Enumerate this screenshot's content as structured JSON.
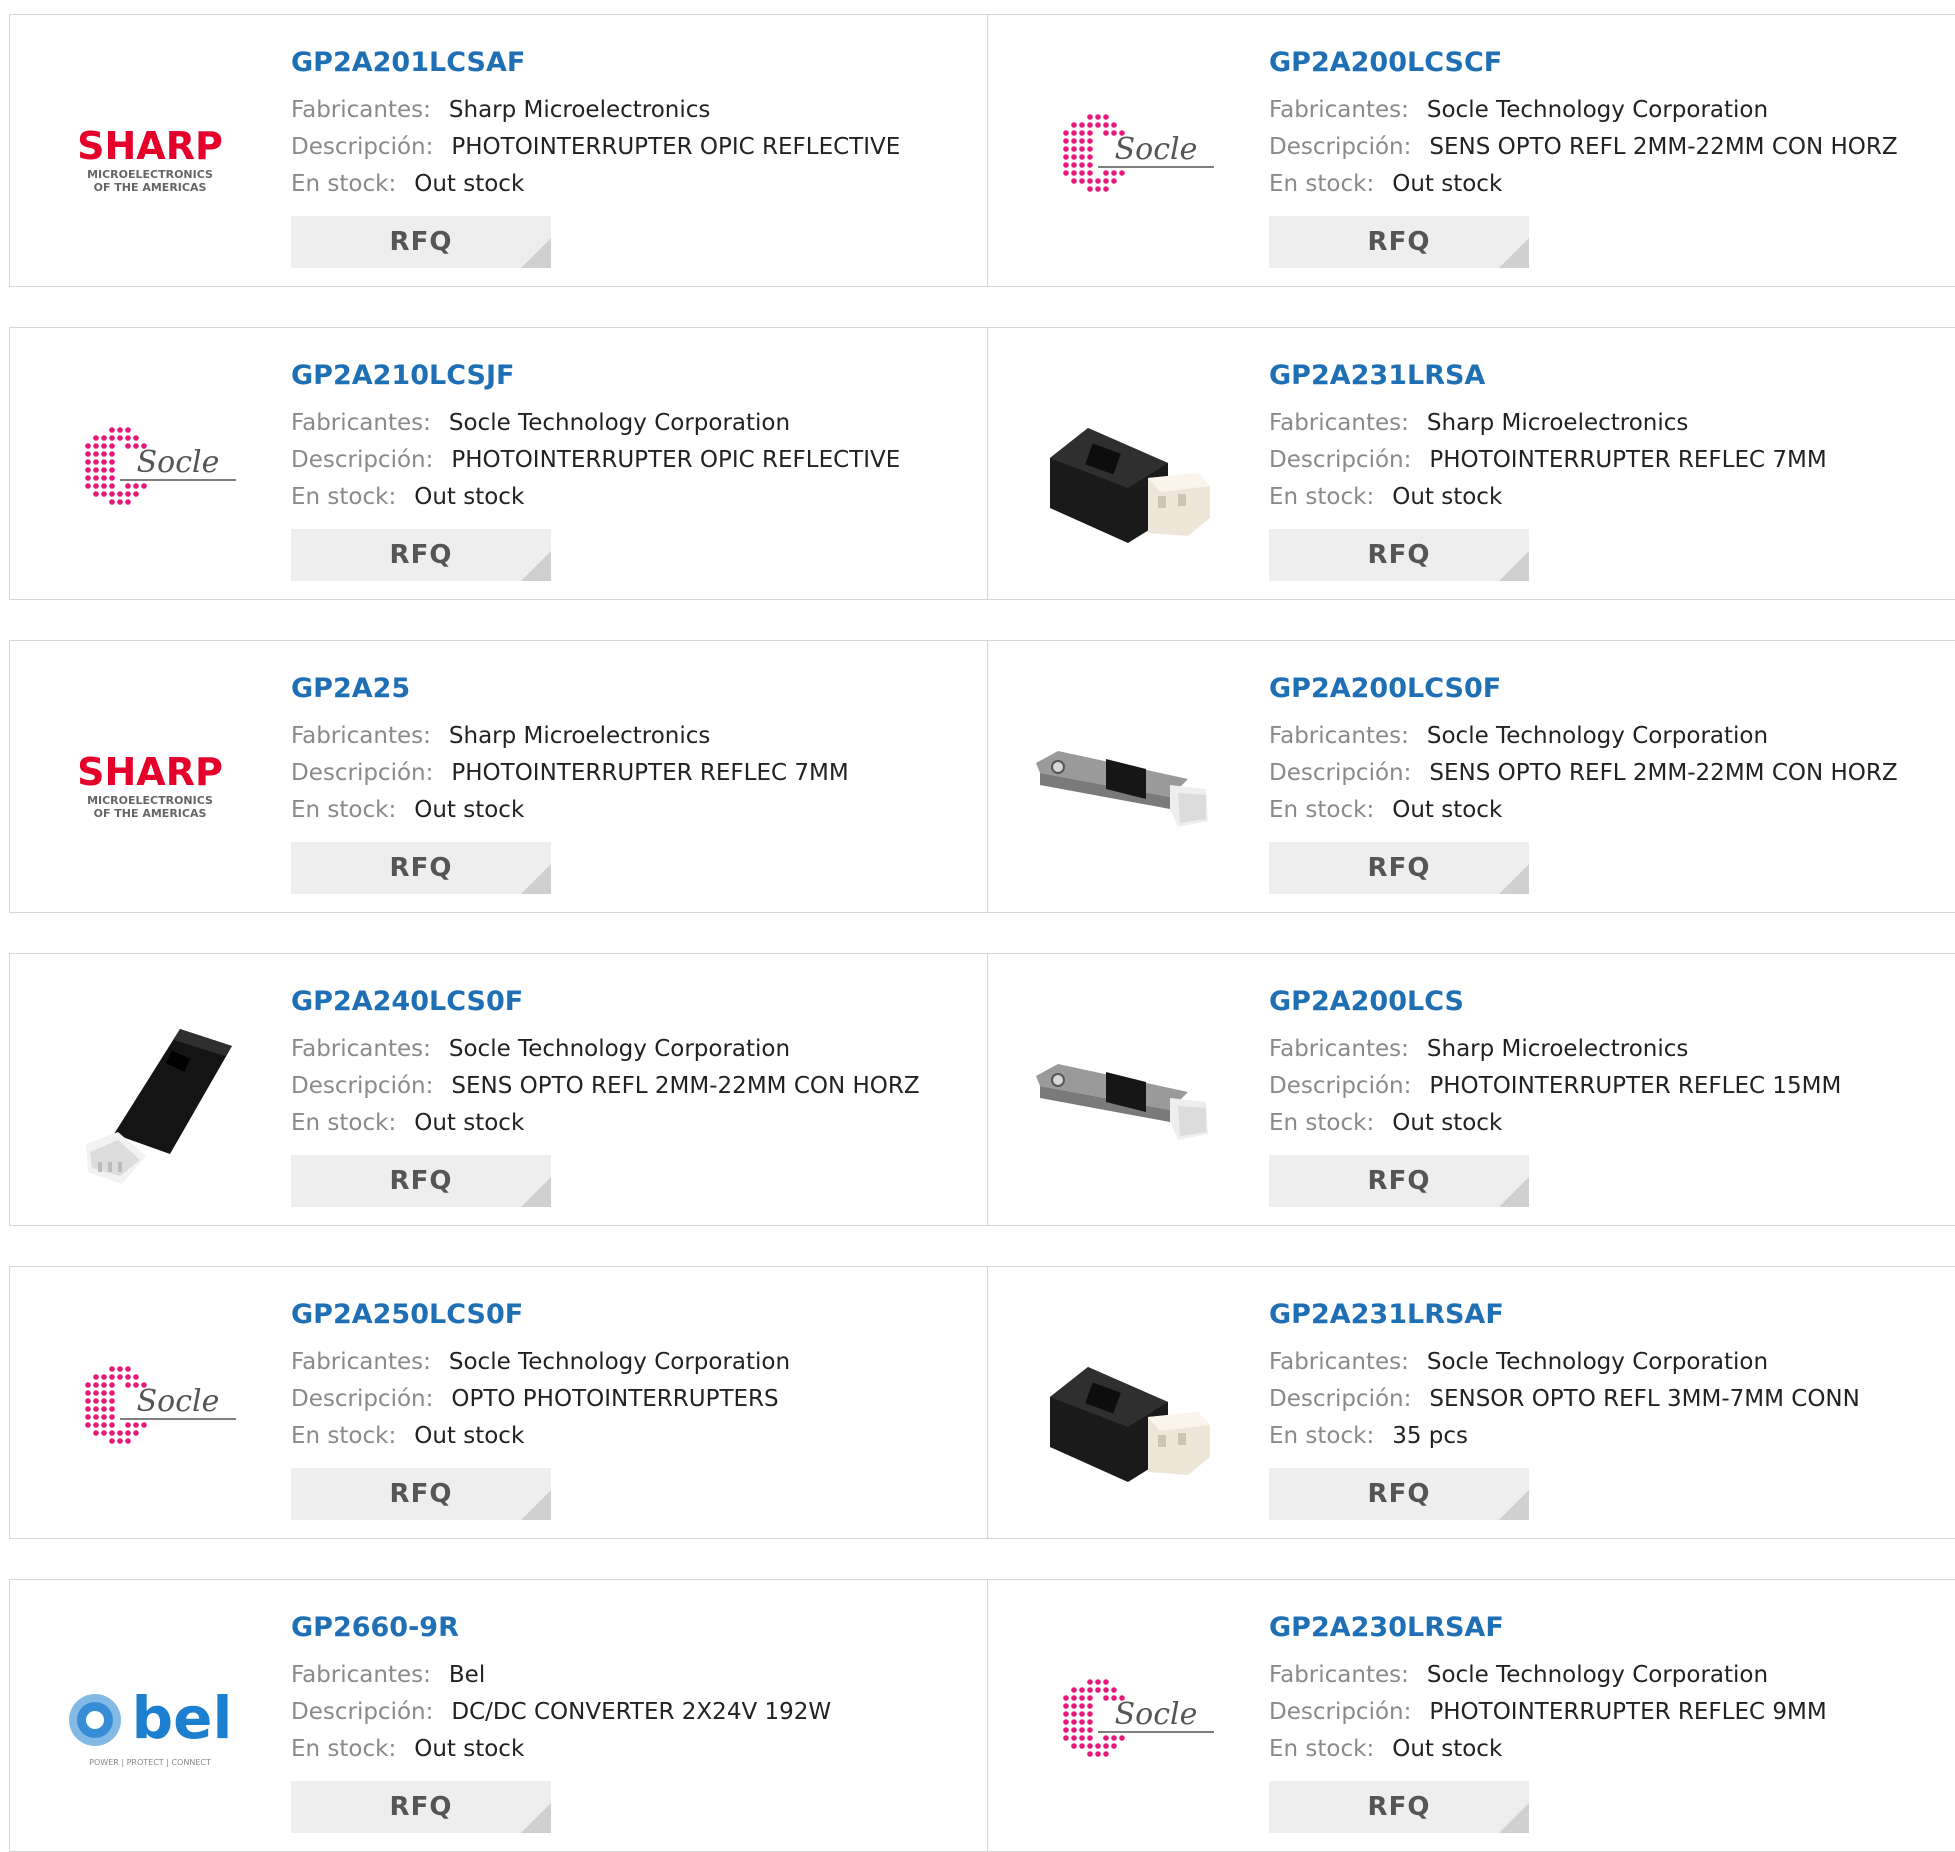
{
  "labels": {
    "manufacturer": "Fabricantes:",
    "description": "Descripción:",
    "stock": "En stock:",
    "rfq": "RFQ"
  },
  "logo_text": {
    "sharp_main": "SHARP",
    "sharp_sub1": "MICROELECTRONICS",
    "sharp_sub2": "OF THE AMERICAS",
    "socle": "Socle",
    "bel_main": "bel",
    "bel_tag": "POWER | PROTECT | CONNECT"
  },
  "colors": {
    "part_link": "#1f6fb5",
    "sharp_red": "#e4002b",
    "socle_pink": "#e6197a",
    "bel_blue": "#1c7fd0"
  },
  "products": [
    {
      "part": "GP2A201LCSAF",
      "manufacturer": "Sharp Microelectronics",
      "description": "PHOTOINTERRUPTER OPIC REFLECTIVE",
      "stock": "Out stock",
      "image": "sharp-logo"
    },
    {
      "part": "GP2A200LCSCF",
      "manufacturer": "Socle Technology Corporation",
      "description": "SENS OPTO REFL 2MM-22MM CON HORZ",
      "stock": "Out stock",
      "image": "socle-logo"
    },
    {
      "part": "GP2A210LCSJF",
      "manufacturer": "Socle Technology Corporation",
      "description": "PHOTOINTERRUPTER OPIC REFLECTIVE",
      "stock": "Out stock",
      "image": "socle-logo"
    },
    {
      "part": "GP2A231LRSA",
      "manufacturer": "Sharp Microelectronics",
      "description": "PHOTOINTERRUPTER REFLEC 7MM",
      "stock": "Out stock",
      "image": "sensor-block-photo"
    },
    {
      "part": "GP2A25",
      "manufacturer": "Sharp Microelectronics",
      "description": "PHOTOINTERRUPTER REFLEC 7MM",
      "stock": "Out stock",
      "image": "sharp-logo"
    },
    {
      "part": "GP2A200LCS0F",
      "manufacturer": "Socle Technology Corporation",
      "description": "SENS OPTO REFL 2MM-22MM CON HORZ",
      "stock": "Out stock",
      "image": "sensor-bar-photo"
    },
    {
      "part": "GP2A240LCS0F",
      "manufacturer": "Socle Technology Corporation",
      "description": "SENS OPTO REFL 2MM-22MM CON HORZ",
      "stock": "Out stock",
      "image": "sensor-vertical-photo"
    },
    {
      "part": "GP2A200LCS",
      "manufacturer": "Sharp Microelectronics",
      "description": "PHOTOINTERRUPTER REFLEC 15MM",
      "stock": "Out stock",
      "image": "sensor-bar-photo"
    },
    {
      "part": "GP2A250LCS0F",
      "manufacturer": "Socle Technology Corporation",
      "description": "OPTO PHOTOINTERRUPTERS",
      "stock": "Out stock",
      "image": "socle-logo"
    },
    {
      "part": "GP2A231LRSAF",
      "manufacturer": "Socle Technology Corporation",
      "description": "SENSOR OPTO REFL 3MM-7MM CONN",
      "stock": "35 pcs",
      "image": "sensor-block-photo"
    },
    {
      "part": "GP2660-9R",
      "manufacturer": "Bel",
      "description": "DC/DC CONVERTER 2X24V 192W",
      "stock": "Out stock",
      "image": "bel-logo"
    },
    {
      "part": "GP2A230LRSAF",
      "manufacturer": "Socle Technology Corporation",
      "description": "PHOTOINTERRUPTER REFLEC 9MM",
      "stock": "Out stock",
      "image": "socle-logo"
    }
  ]
}
